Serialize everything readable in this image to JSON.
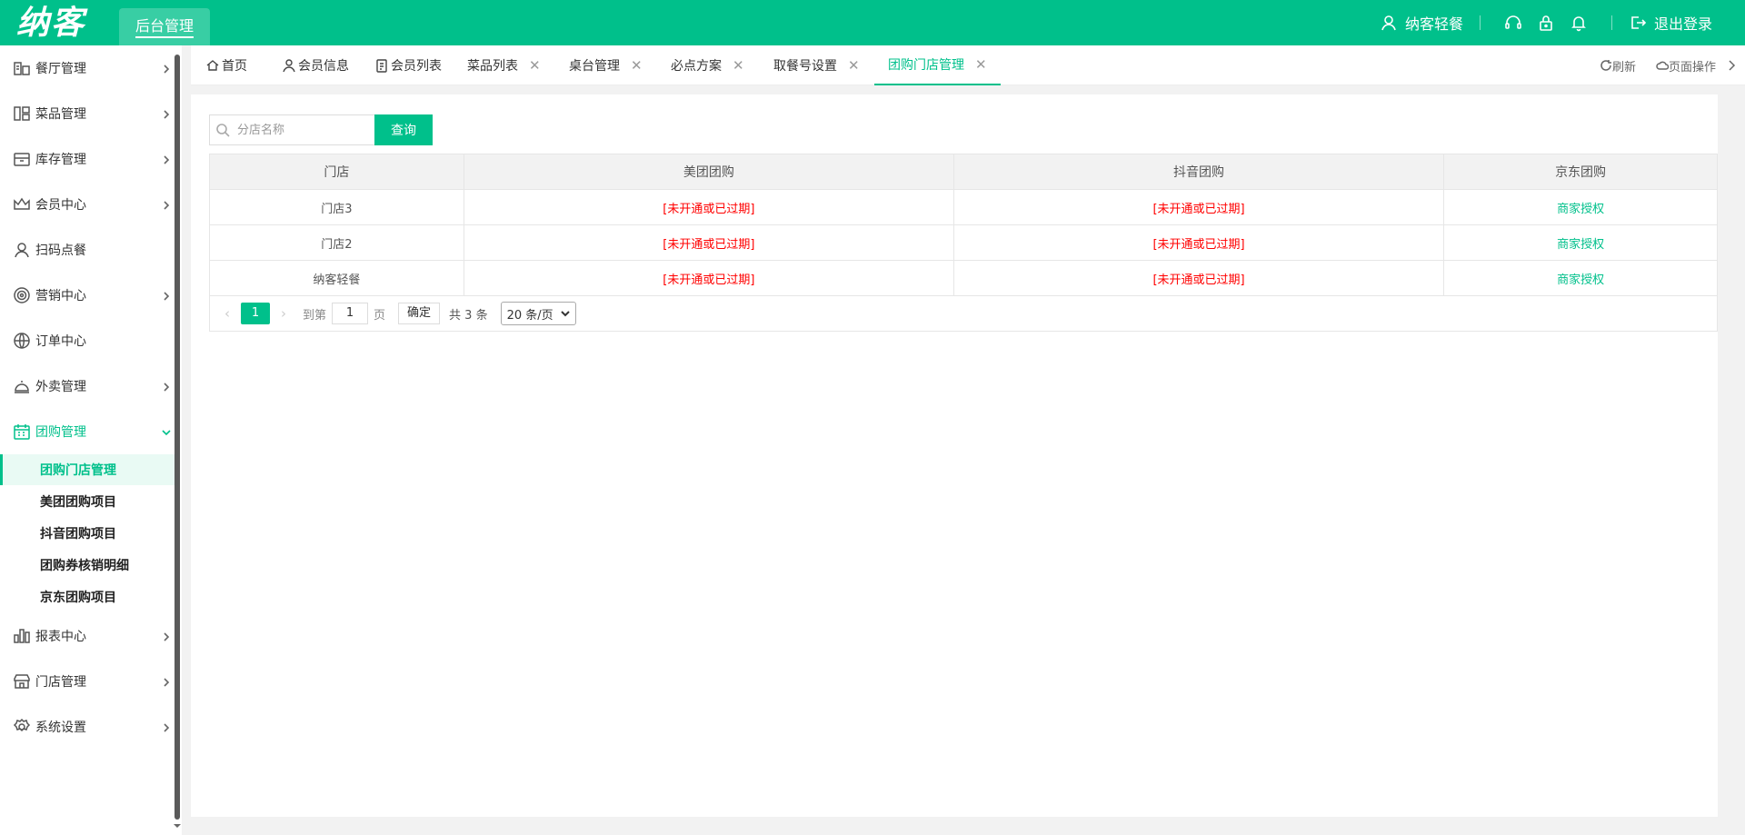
{
  "header": {
    "logo": "纳客",
    "admin_tab": "后台管理",
    "user": "纳客轻餐",
    "logout": "退出登录"
  },
  "sidebar": {
    "items": [
      {
        "label": "餐厅管理",
        "icon": "restaurant-icon"
      },
      {
        "label": "菜品管理",
        "icon": "dishes-icon"
      },
      {
        "label": "库存管理",
        "icon": "inventory-icon"
      },
      {
        "label": "会员中心",
        "icon": "crown-icon"
      },
      {
        "label": "扫码点餐",
        "icon": "user-icon"
      },
      {
        "label": "营销中心",
        "icon": "target-icon"
      },
      {
        "label": "订单中心",
        "icon": "globe-icon"
      },
      {
        "label": "外卖管理",
        "icon": "bell-cloche-icon"
      },
      {
        "label": "团购管理",
        "icon": "calendar-icon"
      },
      {
        "label": "报表中心",
        "icon": "bar-chart-icon"
      },
      {
        "label": "门店管理",
        "icon": "store-icon"
      },
      {
        "label": "系统设置",
        "icon": "gear-icon"
      }
    ],
    "sub_items": [
      {
        "label": "团购门店管理"
      },
      {
        "label": "美团团购项目"
      },
      {
        "label": "抖音团购项目"
      },
      {
        "label": "团购券核销明细"
      },
      {
        "label": "京东团购项目"
      }
    ]
  },
  "tabs": [
    {
      "label": "首页"
    },
    {
      "label": "会员信息"
    },
    {
      "label": "会员列表"
    },
    {
      "label": "菜品列表"
    },
    {
      "label": "桌台管理"
    },
    {
      "label": "必点方案"
    },
    {
      "label": "取餐号设置"
    },
    {
      "label": "团购门店管理"
    }
  ],
  "tabbar_right": {
    "refresh": "刷新",
    "page_ops": "页面操作"
  },
  "search": {
    "placeholder": "分店名称",
    "button": "查询"
  },
  "table": {
    "headers": [
      "门店",
      "美团团购",
      "抖音团购",
      "京东团购"
    ],
    "rows": [
      [
        "门店3",
        "[未开通或已过期]",
        "[未开通或已过期]",
        "商家授权"
      ],
      [
        "门店2",
        "[未开通或已过期]",
        "[未开通或已过期]",
        "商家授权"
      ],
      [
        "纳客轻餐",
        "[未开通或已过期]",
        "[未开通或已过期]",
        "商家授权"
      ]
    ]
  },
  "pager": {
    "current": "1",
    "goto_label": "到第",
    "goto_value": "1",
    "page_unit": "页",
    "confirm": "确定",
    "total": "共 3 条",
    "page_size": "20 条/页"
  },
  "colors": {
    "brand": "#00c08b",
    "error": "#ff0000"
  }
}
